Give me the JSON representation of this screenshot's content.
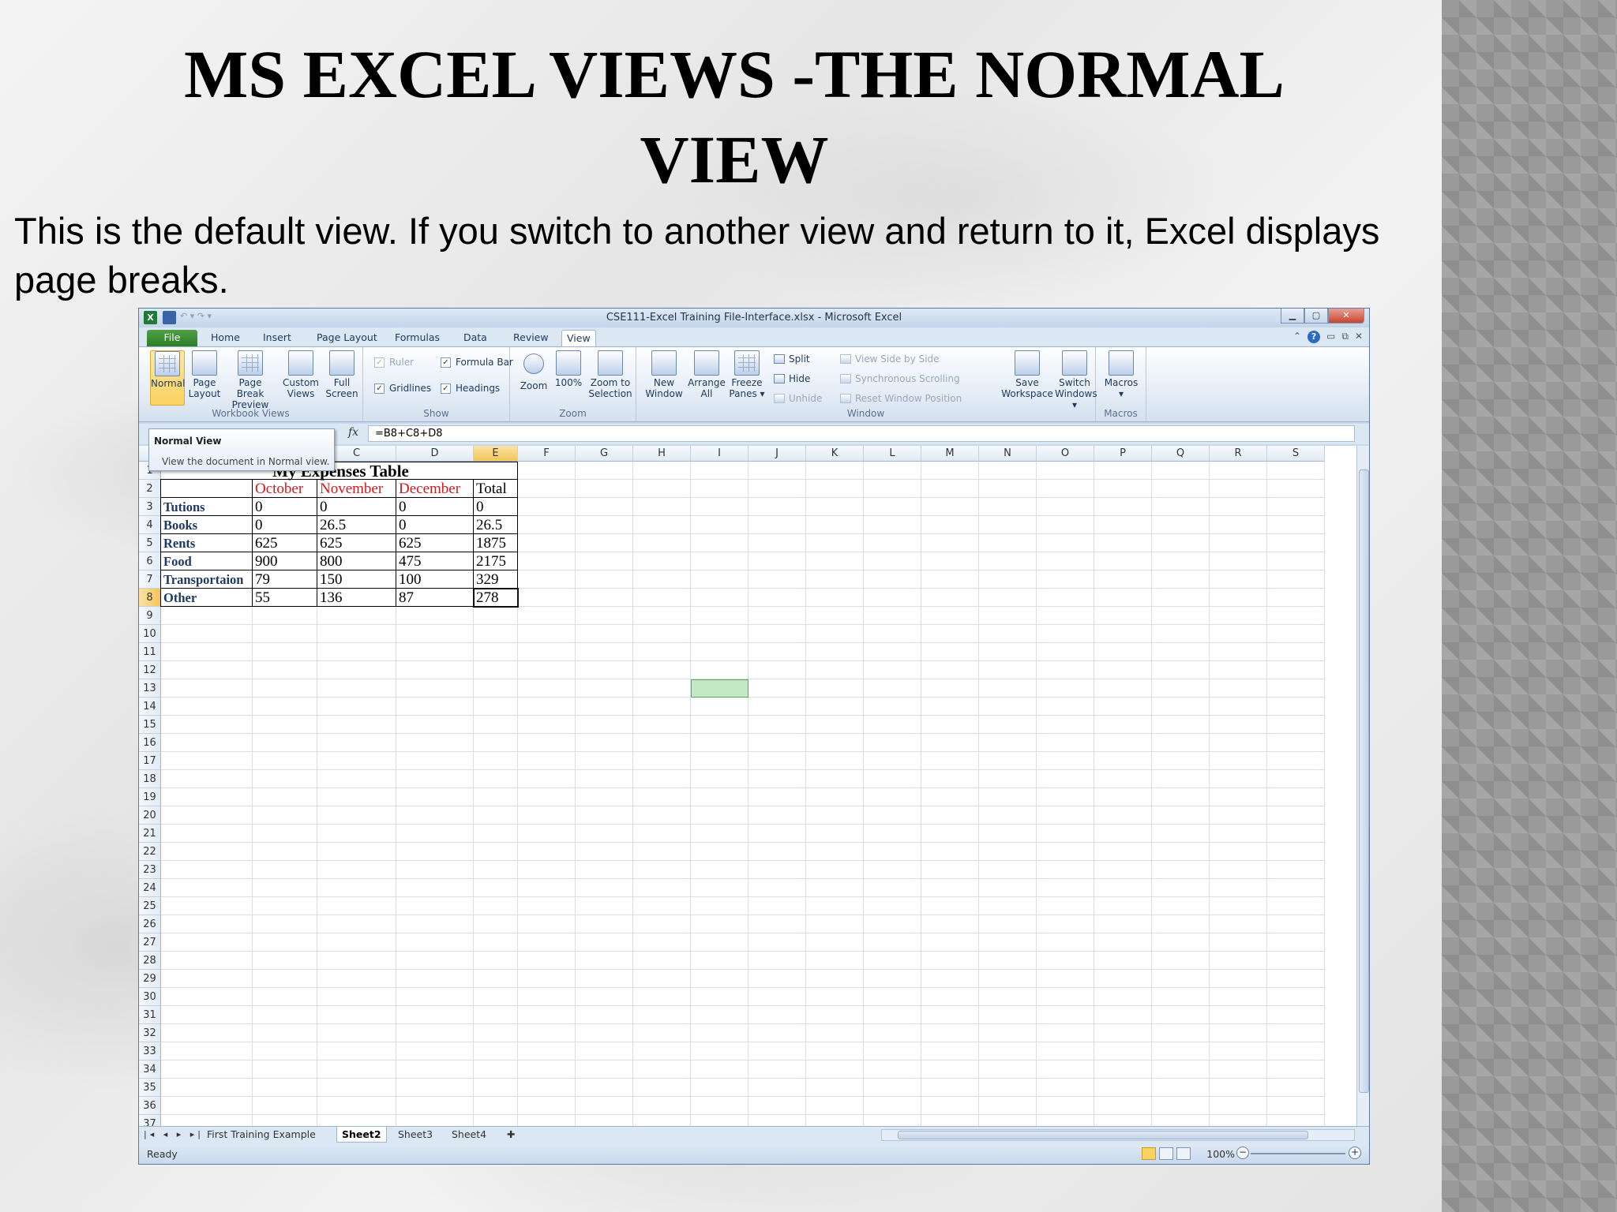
{
  "slide": {
    "title_line1": "MS EXCEL VIEWS -THE NORMAL",
    "title_line2": "VIEW",
    "body_line1": "This is the default view. If you switch to another view and return to it, Excel displays",
    "body_line2": "page breaks."
  },
  "excel": {
    "window_title": "CSE111-Excel Training File-Interface.xlsx  -  Microsoft Excel",
    "tabs": [
      "File",
      "Home",
      "Insert",
      "Page Layout",
      "Formulas",
      "Data",
      "Review",
      "View"
    ],
    "active_tab": "View",
    "ribbon": {
      "workbook_views": {
        "label": "Workbook Views",
        "normal": "Normal",
        "page_layout": [
          "Page",
          "Layout"
        ],
        "page_break": [
          "Page Break",
          "Preview"
        ],
        "custom_views": [
          "Custom",
          "Views"
        ],
        "full_screen": [
          "Full",
          "Screen"
        ]
      },
      "show": {
        "label": "Show",
        "ruler": "Ruler",
        "formula_bar": "Formula Bar",
        "gridlines": "Gridlines",
        "headings": "Headings"
      },
      "zoom": {
        "label": "Zoom",
        "zoom": "Zoom",
        "hundred": "100%",
        "zoom_to_selection": [
          "Zoom to",
          "Selection"
        ]
      },
      "window": {
        "label": "Window",
        "new_window": [
          "New",
          "Window"
        ],
        "arrange_all": [
          "Arrange",
          "All"
        ],
        "freeze_panes": [
          "Freeze",
          "Panes ▾"
        ],
        "split": "Split",
        "hide": "Hide",
        "unhide": "Unhide",
        "view_side_by_side": "View Side by Side",
        "synchronous_scrolling": "Synchronous Scrolling",
        "reset_window_position": "Reset Window Position",
        "save_workspace": [
          "Save",
          "Workspace"
        ],
        "switch_windows": [
          "Switch",
          "Windows ▾"
        ]
      },
      "macros": {
        "label": "Macros",
        "macros": "Macros"
      }
    },
    "formula": "=B8+C8+D8",
    "fx": "fx",
    "tooltip": {
      "title": "Normal View",
      "desc": "View the document in Normal view."
    },
    "columns": [
      "C",
      "D",
      "E",
      "F",
      "G",
      "H",
      "I",
      "J",
      "K",
      "L",
      "M",
      "N",
      "O",
      "P",
      "Q",
      "R",
      "S"
    ],
    "selected_column": "E",
    "selected_row": "8",
    "table": {
      "title": "My Expenses Table",
      "headers": [
        "October",
        "November",
        "December",
        "Total"
      ],
      "rows": [
        {
          "label": "Tutions",
          "values": [
            "0",
            "0",
            "0",
            "0"
          ]
        },
        {
          "label": "Books",
          "values": [
            "0",
            "26.5",
            "0",
            "26.5"
          ]
        },
        {
          "label": "Rents",
          "values": [
            "625",
            "625",
            "625",
            "1875"
          ]
        },
        {
          "label": "Food",
          "values": [
            "900",
            "800",
            "475",
            "2175"
          ]
        },
        {
          "label": "Transportaion",
          "values": [
            "79",
            "150",
            "100",
            "329"
          ]
        },
        {
          "label": "Other",
          "values": [
            "55",
            "136",
            "87",
            "278"
          ]
        }
      ]
    },
    "sheet_tabs": [
      "First Training Example",
      "Sheet2",
      "Sheet3",
      "Sheet4"
    ],
    "active_sheet": "Sheet2",
    "status": {
      "ready": "Ready",
      "zoom": "100%"
    }
  }
}
